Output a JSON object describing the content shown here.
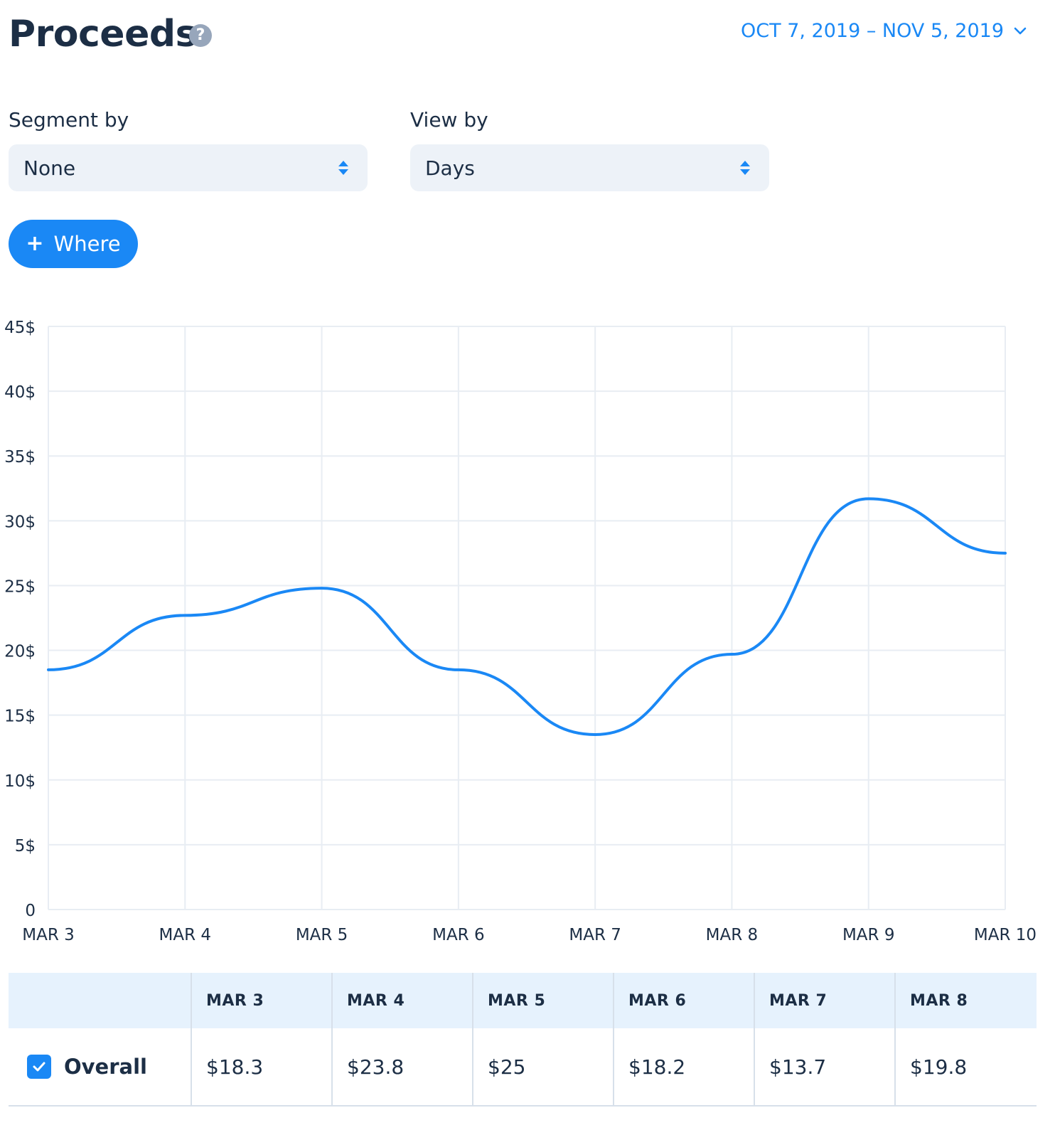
{
  "header": {
    "title": "Proceeds",
    "help_icon": "question-circle-icon",
    "date_range": "OCT 7, 2019 – NOV 5, 2019"
  },
  "filters": {
    "segment_label": "Segment by",
    "segment_value": "None",
    "view_label": "View by",
    "view_value": "Days",
    "where_button": "Where"
  },
  "colors": {
    "accent": "#1a88f5",
    "text": "#1c2e45",
    "grid": "#e8edf3"
  },
  "chart_data": {
    "type": "line",
    "x": [
      "MAR 3",
      "MAR 4",
      "MAR 5",
      "MAR 6",
      "MAR 7",
      "MAR 8",
      "MAR 9",
      "MAR 10"
    ],
    "series": [
      {
        "values": [
          18.5,
          22.7,
          24.8,
          18.5,
          13.5,
          19.7,
          31.7,
          27.5
        ]
      }
    ],
    "yticks": [
      "0",
      "5$",
      "10$",
      "15$",
      "20$",
      "25$",
      "30$",
      "35$",
      "40$",
      "45$"
    ],
    "ylim": [
      0,
      45
    ],
    "grid": true,
    "smooth": true
  },
  "table": {
    "columns": [
      "MAR 3",
      "MAR 4",
      "MAR 5",
      "MAR 6",
      "MAR 7",
      "MAR 8"
    ],
    "row_label": "Overall",
    "row_checked": true,
    "values": [
      "$18.3",
      "$23.8",
      "$25",
      "$18.2",
      "$13.7",
      "$19.8"
    ]
  }
}
